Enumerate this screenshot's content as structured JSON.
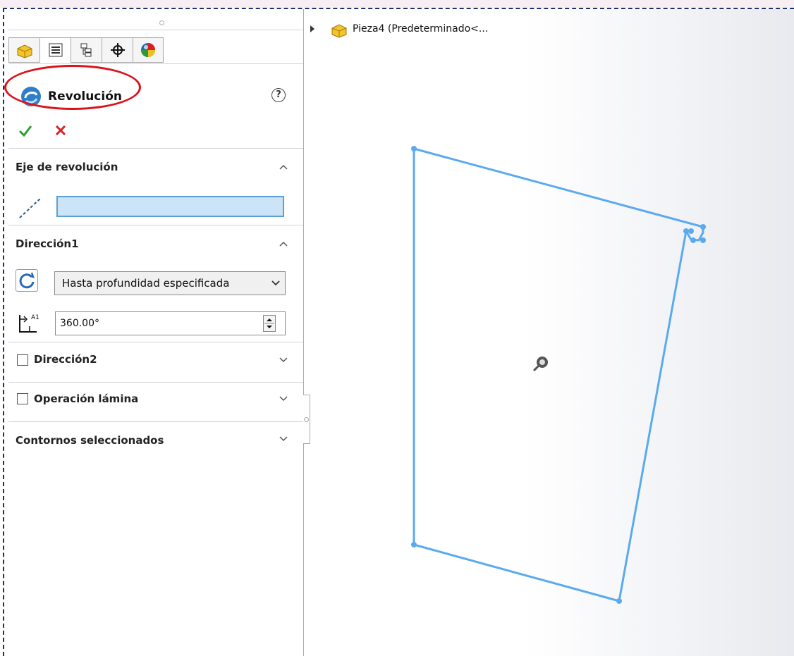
{
  "window": {
    "tree_label": "Pieza4  (Predeterminado<..."
  },
  "property_manager": {
    "title": "Revolución",
    "help_symbol": "?",
    "tabs": [
      {
        "name": "feature-manager-tab",
        "icon": "part-icon"
      },
      {
        "name": "property-manager-tab",
        "icon": "property-list-icon",
        "active": true
      },
      {
        "name": "configuration-manager-tab",
        "icon": "configuration-icon"
      },
      {
        "name": "dimxpert-manager-tab",
        "icon": "crosshair-icon"
      },
      {
        "name": "display-manager-tab",
        "icon": "appearance-ball-icon"
      }
    ],
    "sections": {
      "axis": {
        "title": "Eje de revolución",
        "field_value": ""
      },
      "direction1": {
        "title": "Dirección1",
        "end_condition": "Hasta profundidad especificada",
        "angle": "360.00°"
      },
      "direction2": {
        "title": "Dirección2",
        "checked": false
      },
      "thin_feature": {
        "title": "Operación lámina",
        "checked": false
      },
      "selected_contours": {
        "title": "Contornos seleccionados"
      }
    }
  },
  "colors": {
    "sketch_line": "#5aaaf0",
    "accent_red": "#d9141a",
    "ok_green": "#2f9e2f",
    "cancel_red": "#e02020",
    "frame_dash": "#1d2f6b"
  }
}
